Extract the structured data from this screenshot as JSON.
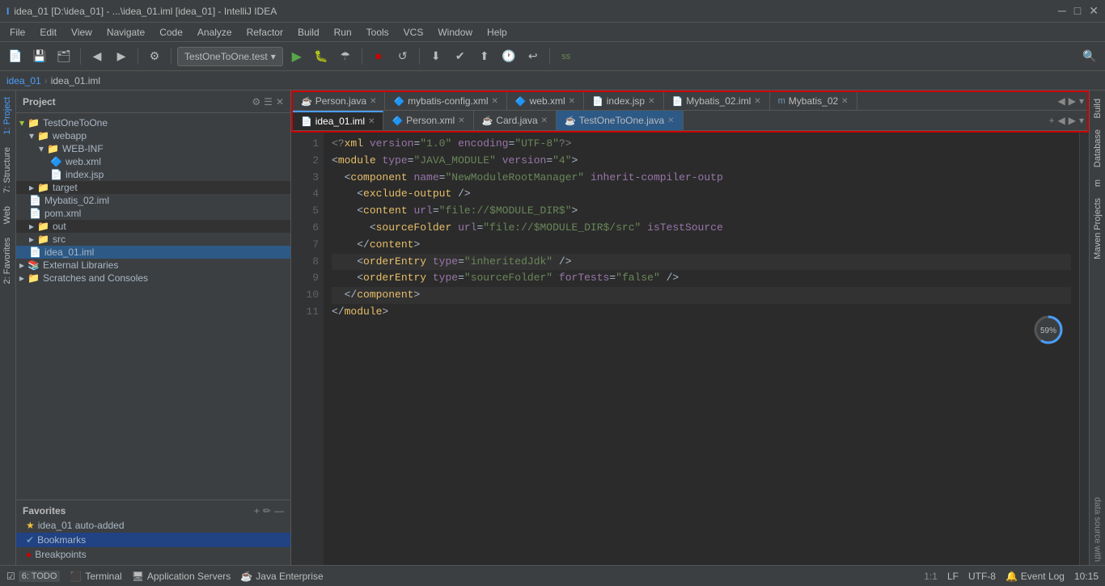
{
  "titleBar": {
    "title": "idea_01 [D:\\idea_01] - ...\\idea_01.iml [idea_01] - IntelliJ IDEA",
    "controls": [
      "─",
      "□",
      "✕"
    ]
  },
  "menuBar": {
    "items": [
      "File",
      "Edit",
      "View",
      "Navigate",
      "Code",
      "Analyze",
      "Refactor",
      "Build",
      "Run",
      "Tools",
      "VCS",
      "Window",
      "Help"
    ]
  },
  "toolbar": {
    "config": "TestOneToOne.test",
    "search_placeholder": "ss"
  },
  "breadcrumb": {
    "parts": [
      "idea_01",
      "idea_01.iml"
    ]
  },
  "projectPanel": {
    "title": "Project",
    "tree": [
      {
        "id": "testonetoone",
        "label": "TestOneToOne",
        "indent": 0,
        "type": "root",
        "icon": "📁"
      },
      {
        "id": "webapp",
        "label": "webapp",
        "indent": 1,
        "type": "folder",
        "icon": "📁"
      },
      {
        "id": "webinf",
        "label": "WEB-INF",
        "indent": 2,
        "type": "folder",
        "icon": "📁"
      },
      {
        "id": "webxml",
        "label": "web.xml",
        "indent": 3,
        "type": "xml",
        "icon": "🔷"
      },
      {
        "id": "indexjsp",
        "label": "index.jsp",
        "indent": 3,
        "type": "jsp",
        "icon": "🔶"
      },
      {
        "id": "target",
        "label": "target",
        "indent": 1,
        "type": "folder-yellow",
        "icon": "📁"
      },
      {
        "id": "mybatis02iml",
        "label": "Mybatis_02.iml",
        "indent": 1,
        "type": "iml",
        "icon": "📄"
      },
      {
        "id": "pomxml",
        "label": "pom.xml",
        "indent": 1,
        "type": "pom",
        "icon": "📄"
      },
      {
        "id": "out",
        "label": "out",
        "indent": 1,
        "type": "folder-yellow",
        "icon": "📁"
      },
      {
        "id": "src",
        "label": "src",
        "indent": 1,
        "type": "folder",
        "icon": "📁"
      },
      {
        "id": "idea01iml",
        "label": "idea_01.iml",
        "indent": 1,
        "type": "iml",
        "icon": "📄"
      },
      {
        "id": "extlibs",
        "label": "External Libraries",
        "indent": 0,
        "type": "libs",
        "icon": "📚"
      },
      {
        "id": "scratches",
        "label": "Scratches and Consoles",
        "indent": 0,
        "type": "folder",
        "icon": "📁"
      }
    ]
  },
  "favoritesPanel": {
    "title": "Favorites",
    "items": [
      {
        "id": "idea01",
        "label": "idea_01  auto-added",
        "type": "star"
      },
      {
        "id": "bookmarks",
        "label": "Bookmarks",
        "type": "bookmark",
        "active": true
      },
      {
        "id": "breakpoints",
        "label": "Breakpoints",
        "type": "breakpoint"
      }
    ]
  },
  "editorTabs": {
    "row1": [
      {
        "id": "person-java",
        "label": "Person.java",
        "type": "java",
        "active": false
      },
      {
        "id": "mybatis-config",
        "label": "mybatis-config.xml",
        "type": "xml",
        "active": false
      },
      {
        "id": "web-xml",
        "label": "web.xml",
        "type": "xml",
        "active": false
      },
      {
        "id": "index-jsp",
        "label": "index.jsp",
        "type": "jsp",
        "active": false
      },
      {
        "id": "mybatis02-iml",
        "label": "Mybatis_02.iml",
        "type": "iml",
        "active": false
      },
      {
        "id": "mybatis02",
        "label": "Mybatis_02",
        "type": "java",
        "active": false
      }
    ],
    "row2": [
      {
        "id": "idea01-iml",
        "label": "idea_01.iml",
        "type": "iml",
        "active": true
      },
      {
        "id": "person-xml",
        "label": "Person.xml",
        "type": "xml",
        "active": false
      },
      {
        "id": "card-java",
        "label": "Card.java",
        "type": "java",
        "active": false
      },
      {
        "id": "testonetoone-java",
        "label": "TestOneToOne.java",
        "type": "java",
        "active": false
      }
    ]
  },
  "codeLines": [
    {
      "num": 1,
      "content": "<?xml version=\"1.0\" encoding=\"UTF-8\"?>",
      "highlight": false
    },
    {
      "num": 2,
      "content": "<module type=\"JAVA_MODULE\" version=\"4\">",
      "highlight": false
    },
    {
      "num": 3,
      "content": "  <component name=\"NewModuleRootManager\" inherit-compiler-outp",
      "highlight": false
    },
    {
      "num": 4,
      "content": "    <exclude-output />",
      "highlight": false
    },
    {
      "num": 5,
      "content": "    <content url=\"file://$MODULE_DIR$\">",
      "highlight": false
    },
    {
      "num": 6,
      "content": "      <sourceFolder url=\"file://$MODULE_DIR$/src\" isTestSource",
      "highlight": false
    },
    {
      "num": 7,
      "content": "    </content>",
      "highlight": false
    },
    {
      "num": 8,
      "content": "    <orderEntry type=\"inheritedJdk\" />",
      "highlight": true
    },
    {
      "num": 9,
      "content": "    <orderEntry type=\"sourceFolder\" forTests=\"false\" />",
      "highlight": false
    },
    {
      "num": 10,
      "content": "  </component>",
      "highlight": true
    },
    {
      "num": 11,
      "content": "</module>",
      "highlight": false
    }
  ],
  "rightSidebar": {
    "panels": [
      "Build",
      "Database",
      "m",
      "Maven Projects"
    ]
  },
  "statusBar": {
    "todo": "6: TODO",
    "terminal": "Terminal",
    "appServers": "Application Servers",
    "javaEnt": "Java Enterprise",
    "eventLog": "Event Log",
    "time": "10:15",
    "encoding": "UTF-8",
    "lineEnding": "LF",
    "position": "1:1"
  },
  "progressCircle": {
    "value": 59,
    "label": "59%"
  }
}
